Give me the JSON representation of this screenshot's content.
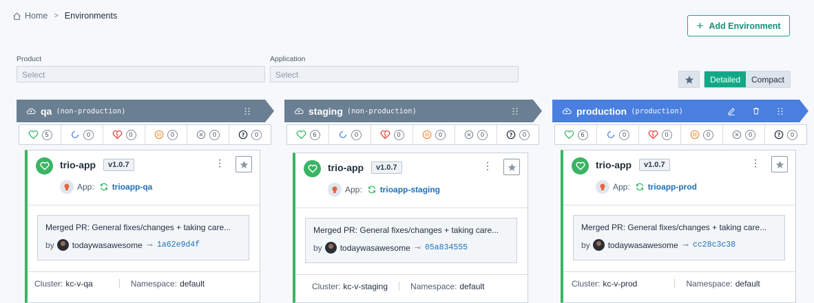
{
  "breadcrumb": {
    "home": "Home",
    "separator": ">",
    "current": "Environments"
  },
  "toolbar": {
    "add_environment": "Add Environment"
  },
  "filters": {
    "product": {
      "label": "Product",
      "placeholder": "Select"
    },
    "application": {
      "label": "Application",
      "placeholder": "Select"
    }
  },
  "view": {
    "detailed": "Detailed",
    "compact": "Compact",
    "selected": "Detailed"
  },
  "colors": {
    "accent": "#12a885",
    "healthy": "#3bb464",
    "header_gray": "#6b7f93",
    "header_blue": "#4a7fe0",
    "link": "#1f6fb7"
  },
  "environments": [
    {
      "name": "qa",
      "type": "(non-production)",
      "counts": {
        "healthy": "5",
        "progressing": "0",
        "degraded": "0",
        "suspended": "0",
        "missing": "0",
        "unknown": "0"
      },
      "card": {
        "app": "trio-app",
        "version": "v1.0.7",
        "app_label": "App:",
        "app_link": "trioapp-qa",
        "pr_title": "Merged PR: General fixes/changes + taking care...",
        "by": "by",
        "author": "todaywasawesome",
        "sha": "1a62e9d4f",
        "cluster_label": "Cluster:",
        "cluster": "kc-v-qa",
        "namespace_label": "Namespace:",
        "namespace": "default"
      }
    },
    {
      "name": "staging",
      "type": "(non-production)",
      "counts": {
        "healthy": "6",
        "progressing": "0",
        "degraded": "0",
        "suspended": "0",
        "missing": "0",
        "unknown": "0"
      },
      "card": {
        "app": "trio-app",
        "version": "v1.0.7",
        "app_label": "App:",
        "app_link": "trioapp-staging",
        "pr_title": "Merged PR: General fixes/changes + taking care...",
        "by": "by",
        "author": "todaywasawesome",
        "sha": "05a834555",
        "cluster_label": "Cluster:",
        "cluster": "kc-v-staging",
        "namespace_label": "Namespace:",
        "namespace": "default"
      }
    },
    {
      "name": "production",
      "type": "(production)",
      "counts": {
        "healthy": "6",
        "progressing": "0",
        "degraded": "0",
        "suspended": "0",
        "missing": "0",
        "unknown": "0"
      },
      "card": {
        "app": "trio-app",
        "version": "v1.0.7",
        "app_label": "App:",
        "app_link": "trioapp-prod",
        "pr_title": "Merged PR: General fixes/changes + taking care...",
        "by": "by",
        "author": "todaywasawesome",
        "sha": "cc28c3c38",
        "cluster_label": "Cluster:",
        "cluster": "kc-v-prod",
        "namespace_label": "Namespace:",
        "namespace": "default"
      }
    }
  ]
}
